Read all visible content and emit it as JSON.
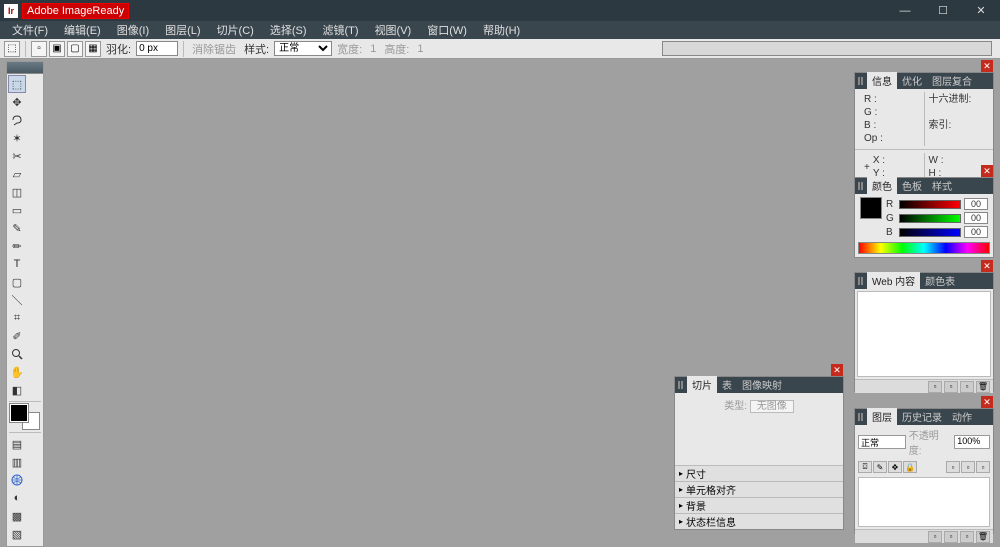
{
  "titlebar": {
    "app": "Adobe ImageReady"
  },
  "menu": [
    "文件(F)",
    "编辑(E)",
    "图像(I)",
    "图层(L)",
    "切片(C)",
    "选择(S)",
    "滤镜(T)",
    "视图(V)",
    "窗口(W)",
    "帮助(H)"
  ],
  "options": {
    "feather_label": "羽化:",
    "feather_value": "0 px",
    "antialias": "消除锯齿",
    "style_label": "样式:",
    "style_value": "正常",
    "width_label": "宽度:",
    "width_value": "1",
    "height_label": "高度:",
    "height_value": "1"
  },
  "tools_rows": [
    [
      "selection",
      "⬚"
    ],
    [
      "move",
      "↖"
    ],
    [
      "marquee",
      "⬚"
    ],
    [
      "arrow",
      "↗"
    ],
    [
      "lasso",
      "ʃ"
    ],
    [
      "wand",
      "✶"
    ],
    [
      "crop",
      "⌗"
    ],
    [
      "slice",
      "▱"
    ],
    [
      "brush",
      "✎"
    ],
    [
      "pencil",
      "✏"
    ],
    [
      "clone",
      "⎌"
    ],
    [
      "eraser",
      "◫"
    ],
    [
      "type",
      "T"
    ],
    [
      "shape",
      "▭"
    ],
    [
      "line",
      "＼"
    ],
    [
      "bucket",
      "◍"
    ],
    [
      "eyedrop",
      "✑"
    ],
    [
      "zoom",
      "🔍"
    ]
  ],
  "info_panel": {
    "tabs": [
      "信息",
      "优化",
      "图层复合"
    ],
    "rgb": [
      "R :",
      "G :",
      "B :",
      "Op :"
    ],
    "hex": "十六进制:",
    "index": "索引:",
    "xy": [
      "X :",
      "Y :"
    ],
    "wh": [
      "W :",
      "H :"
    ]
  },
  "color_panel": {
    "tabs": [
      "颜色",
      "色板",
      "样式"
    ],
    "channels": [
      "R",
      "G",
      "B"
    ],
    "value": "00"
  },
  "web_panel": {
    "tabs": [
      "Web 内容",
      "颜色表"
    ]
  },
  "slice_panel": {
    "tabs": [
      "切片",
      "表",
      "图像映射"
    ],
    "type_label": "类型:",
    "type_value": "无图像",
    "sections": [
      "尺寸",
      "单元格对齐",
      "背景",
      "状态栏信息"
    ]
  },
  "layers_panel": {
    "tabs": [
      "图层",
      "历史记录",
      "动作"
    ],
    "mode": "正常",
    "opacity_label": "不透明度:",
    "opacity_value": "100%"
  }
}
